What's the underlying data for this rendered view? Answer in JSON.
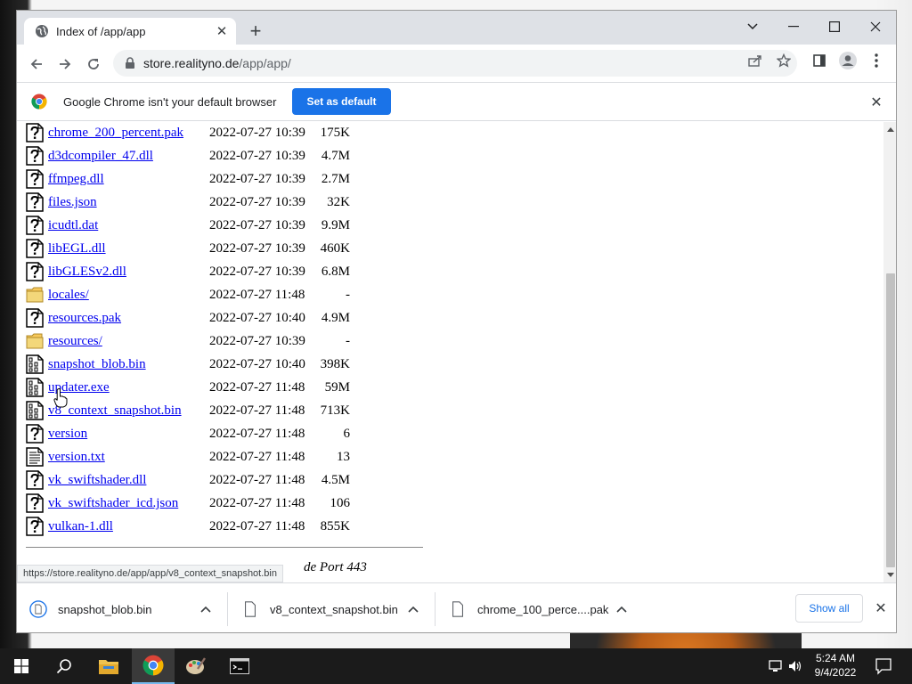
{
  "browser": {
    "tab_title": "Index of /app/app",
    "url_host": "store.realityno.de",
    "url_path": "/app/app/"
  },
  "infobar": {
    "message": "Google Chrome isn't your default browser",
    "button_label": "Set as default"
  },
  "listing": {
    "rows": [
      {
        "name": "chrome_200_percent.pak",
        "date": "2022-07-27 10:39",
        "size": "175K",
        "icon": "unknown-file-icon"
      },
      {
        "name": "d3dcompiler_47.dll",
        "date": "2022-07-27 10:39",
        "size": "4.7M",
        "icon": "unknown-file-icon"
      },
      {
        "name": "ffmpeg.dll",
        "date": "2022-07-27 10:39",
        "size": "2.7M",
        "icon": "unknown-file-icon"
      },
      {
        "name": "files.json",
        "date": "2022-07-27 10:39",
        "size": "32K",
        "icon": "unknown-file-icon"
      },
      {
        "name": "icudtl.dat",
        "date": "2022-07-27 10:39",
        "size": "9.9M",
        "icon": "unknown-file-icon"
      },
      {
        "name": "libEGL.dll",
        "date": "2022-07-27 10:39",
        "size": "460K",
        "icon": "unknown-file-icon"
      },
      {
        "name": "libGLESv2.dll",
        "date": "2022-07-27 10:39",
        "size": "6.8M",
        "icon": "unknown-file-icon"
      },
      {
        "name": "locales/",
        "date": "2022-07-27 11:48",
        "size": "-",
        "icon": "folder-icon"
      },
      {
        "name": "resources.pak",
        "date": "2022-07-27 10:40",
        "size": "4.9M",
        "icon": "unknown-file-icon"
      },
      {
        "name": "resources/",
        "date": "2022-07-27 10:39",
        "size": "-",
        "icon": "folder-icon"
      },
      {
        "name": "snapshot_blob.bin",
        "date": "2022-07-27 10:40",
        "size": "398K",
        "icon": "binary-file-icon"
      },
      {
        "name": "updater.exe",
        "date": "2022-07-27 11:48",
        "size": "59M",
        "icon": "binary-file-icon"
      },
      {
        "name": "v8_context_snapshot.bin",
        "date": "2022-07-27 11:48",
        "size": "713K",
        "icon": "binary-file-icon"
      },
      {
        "name": "version",
        "date": "2022-07-27 11:48",
        "size": "6",
        "icon": "unknown-file-icon"
      },
      {
        "name": "version.txt",
        "date": "2022-07-27 11:48",
        "size": "13",
        "icon": "text-file-icon"
      },
      {
        "name": "vk_swiftshader.dll",
        "date": "2022-07-27 11:48",
        "size": "4.5M",
        "icon": "unknown-file-icon"
      },
      {
        "name": "vk_swiftshader_icd.json",
        "date": "2022-07-27 11:48",
        "size": "106",
        "icon": "unknown-file-icon"
      },
      {
        "name": "vulkan-1.dll",
        "date": "2022-07-27 11:48",
        "size": "855K",
        "icon": "unknown-file-icon"
      }
    ],
    "server_footer": "de Port 443"
  },
  "status_url": "https://store.realityno.de/app/app/v8_context_snapshot.bin",
  "downloads": {
    "items": [
      {
        "name": "snapshot_blob.bin"
      },
      {
        "name": "v8_context_snapshot.bin"
      },
      {
        "name": "chrome_100_perce....pak"
      }
    ],
    "show_all_label": "Show all"
  },
  "taskbar": {
    "time": "5:24 AM",
    "date": "9/4/2022"
  }
}
